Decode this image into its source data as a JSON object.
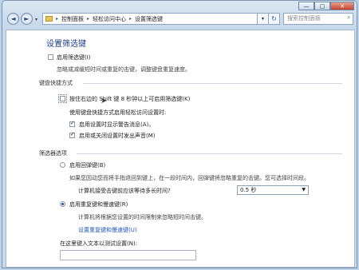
{
  "window": {
    "minimize": "—",
    "maximize": "□",
    "close": "✕"
  },
  "nav": {
    "back": "◄",
    "forward": "►",
    "dropdown": "▾",
    "breadcrumb": [
      "控制面板",
      "轻松访问中心",
      "设置筛选键"
    ],
    "breadcrumb_sep": "▸",
    "refresh": "↻",
    "search_placeholder": "搜索控制面板"
  },
  "page": {
    "title": "设置筛选键",
    "enable_filter_keys": {
      "label": "启用筛选键(I)",
      "checked": false
    },
    "enable_desc": "忽略或减缓短时间或重复的击键，调整键盘重复速度。",
    "shortcut_section": "键盘快捷方式",
    "shift_shortcut": {
      "label": "按住右边的 Shift 键 8 秒钟以上可启用筛选键(K)",
      "checked": false
    },
    "when_using_shortcut": "使用键盘快捷方式启用轻松访问设置时:",
    "show_warning": {
      "label": "启用设置时显示警告消息(A)。",
      "checked": true
    },
    "make_sound": {
      "label": "启用或关闭设置时发出声音(M)",
      "checked": true
    },
    "filter_section": "筛选器选项",
    "bounce_keys": {
      "label": "启用回弹键(B)",
      "checked": false
    },
    "bounce_desc": "如果您因动您而将手指退回到键上，在一段时间内，回弹键将忽略重复的击键。您可选择时间段。",
    "bounce_wait_label": "计算机接受击键前应该等待多长时间?",
    "bounce_wait_value": "0.5 秒",
    "repeat_slow_keys": {
      "label": "启用重复键和慢速键(R)",
      "checked": true
    },
    "repeat_desc": "计算机将根据您设置的时间限制来忽略短时间击键。",
    "repeat_link": "设置重复键和慢速键(U)",
    "test_label": "在这里键入文本以测试设置(N):",
    "test_value": ""
  },
  "icons": {
    "search": "search-icon",
    "folder": "folder-icon",
    "cursor": "mouse-cursor-icon"
  }
}
